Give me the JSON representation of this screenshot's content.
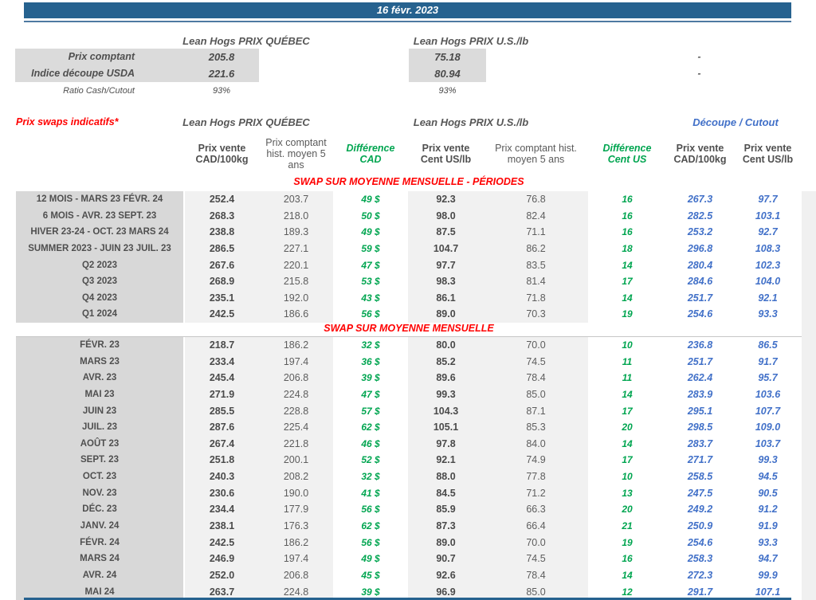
{
  "colors": {
    "header_bar": "#26628F",
    "accent_red": "#FF0000",
    "accent_green": "#00A550",
    "accent_blue": "#4170C8",
    "band_grey": "#DBDBDB",
    "label_col_grey": "#D8D8D8",
    "cell_grey": "#F1F1F1"
  },
  "titlebar": {
    "date": "16 févr. 2023"
  },
  "spot": {
    "quebec_header": "Lean Hogs PRIX QUÉBEC",
    "us_header": "Lean Hogs PRIX U.S./lb",
    "rows": [
      {
        "label": "Prix comptant",
        "qc": "205.8",
        "us": "75.18",
        "cutout": "-"
      },
      {
        "label": "Indice découpe USDA",
        "qc": "221.6",
        "us": "80.94",
        "cutout": "-"
      },
      {
        "label": "Ratio Cash/Cutout",
        "qc": "93%",
        "us": "93%",
        "cutout": ""
      }
    ]
  },
  "swaps": {
    "title": "Prix swaps indicatifs*",
    "quebec_header": "Lean Hogs PRIX QUÉBEC",
    "us_header": "Lean Hogs PRIX U.S./lb",
    "cutout_header": "Découpe / Cutout",
    "columns": [
      {
        "label": "Prix vente CAD/100kg"
      },
      {
        "label": "Prix comptant hist. moyen 5 ans"
      },
      {
        "label": "Différence CAD"
      },
      {
        "label": "Prix vente Cent US/lb"
      },
      {
        "label": "Prix comptant hist. moyen 5 ans"
      },
      {
        "label": "Différence Cent US"
      },
      {
        "label": "Prix vente CAD/100kg"
      },
      {
        "label": "Prix vente Cent US/lb"
      }
    ],
    "periods_title": "SWAP SUR MOYENNE MENSUELLE - PÉRIODES",
    "monthly_title": "SWAP SUR MOYENNE MENSUELLE",
    "periods": [
      {
        "label": "12 MOIS - MARS 23 FÉVR. 24",
        "qc_sell": "252.4",
        "qc_hist": "203.7",
        "diff_cad": "49 $",
        "us_sell": "92.3",
        "us_hist": "76.8",
        "diff_us": "16",
        "cut_cad": "267.3",
        "cut_us": "97.7"
      },
      {
        "label": "6 MOIS - AVR. 23 SEPT. 23",
        "qc_sell": "268.3",
        "qc_hist": "218.0",
        "diff_cad": "50 $",
        "us_sell": "98.0",
        "us_hist": "82.4",
        "diff_us": "16",
        "cut_cad": "282.5",
        "cut_us": "103.1"
      },
      {
        "label": "HIVER 23-24 -  OCT. 23 MARS 24",
        "qc_sell": "238.8",
        "qc_hist": "189.3",
        "diff_cad": "49 $",
        "us_sell": "87.5",
        "us_hist": "71.1",
        "diff_us": "16",
        "cut_cad": "253.2",
        "cut_us": "92.7"
      },
      {
        "label": "SUMMER 2023 - JUIN 23 JUIL. 23",
        "qc_sell": "286.5",
        "qc_hist": "227.1",
        "diff_cad": "59 $",
        "us_sell": "104.7",
        "us_hist": "86.2",
        "diff_us": "18",
        "cut_cad": "296.8",
        "cut_us": "108.3"
      },
      {
        "label": "Q2 2023",
        "qc_sell": "267.6",
        "qc_hist": "220.1",
        "diff_cad": "47 $",
        "us_sell": "97.7",
        "us_hist": "83.5",
        "diff_us": "14",
        "cut_cad": "280.4",
        "cut_us": "102.3"
      },
      {
        "label": "Q3 2023",
        "qc_sell": "268.9",
        "qc_hist": "215.8",
        "diff_cad": "53 $",
        "us_sell": "98.3",
        "us_hist": "81.4",
        "diff_us": "17",
        "cut_cad": "284.6",
        "cut_us": "104.0"
      },
      {
        "label": "Q4 2023",
        "qc_sell": "235.1",
        "qc_hist": "192.0",
        "diff_cad": "43 $",
        "us_sell": "86.1",
        "us_hist": "71.8",
        "diff_us": "14",
        "cut_cad": "251.7",
        "cut_us": "92.1"
      },
      {
        "label": "Q1 2024",
        "qc_sell": "242.5",
        "qc_hist": "186.6",
        "diff_cad": "56 $",
        "us_sell": "89.0",
        "us_hist": "70.3",
        "diff_us": "19",
        "cut_cad": "254.6",
        "cut_us": "93.3"
      }
    ],
    "monthly": [
      {
        "label": "FÉVR. 23",
        "qc_sell": "218.7",
        "qc_hist": "186.2",
        "diff_cad": "32 $",
        "us_sell": "80.0",
        "us_hist": "70.0",
        "diff_us": "10",
        "cut_cad": "236.8",
        "cut_us": "86.5"
      },
      {
        "label": "MARS 23",
        "qc_sell": "233.4",
        "qc_hist": "197.4",
        "diff_cad": "36 $",
        "us_sell": "85.2",
        "us_hist": "74.5",
        "diff_us": "11",
        "cut_cad": "251.7",
        "cut_us": "91.7"
      },
      {
        "label": "AVR. 23",
        "qc_sell": "245.4",
        "qc_hist": "206.8",
        "diff_cad": "39 $",
        "us_sell": "89.6",
        "us_hist": "78.4",
        "diff_us": "11",
        "cut_cad": "262.4",
        "cut_us": "95.7"
      },
      {
        "label": "MAI 23",
        "qc_sell": "271.9",
        "qc_hist": "224.8",
        "diff_cad": "47 $",
        "us_sell": "99.3",
        "us_hist": "85.0",
        "diff_us": "14",
        "cut_cad": "283.9",
        "cut_us": "103.6"
      },
      {
        "label": "JUIN 23",
        "qc_sell": "285.5",
        "qc_hist": "228.8",
        "diff_cad": "57 $",
        "us_sell": "104.3",
        "us_hist": "87.1",
        "diff_us": "17",
        "cut_cad": "295.1",
        "cut_us": "107.7"
      },
      {
        "label": "JUIL. 23",
        "qc_sell": "287.6",
        "qc_hist": "225.4",
        "diff_cad": "62 $",
        "us_sell": "105.1",
        "us_hist": "85.3",
        "diff_us": "20",
        "cut_cad": "298.5",
        "cut_us": "109.0"
      },
      {
        "label": "AOÛT 23",
        "qc_sell": "267.4",
        "qc_hist": "221.8",
        "diff_cad": "46 $",
        "us_sell": "97.8",
        "us_hist": "84.0",
        "diff_us": "14",
        "cut_cad": "283.7",
        "cut_us": "103.7"
      },
      {
        "label": "SEPT. 23",
        "qc_sell": "251.8",
        "qc_hist": "200.1",
        "diff_cad": "52 $",
        "us_sell": "92.1",
        "us_hist": "74.9",
        "diff_us": "17",
        "cut_cad": "271.7",
        "cut_us": "99.3"
      },
      {
        "label": "OCT. 23",
        "qc_sell": "240.3",
        "qc_hist": "208.2",
        "diff_cad": "32 $",
        "us_sell": "88.0",
        "us_hist": "77.8",
        "diff_us": "10",
        "cut_cad": "258.5",
        "cut_us": "94.5"
      },
      {
        "label": "NOV. 23",
        "qc_sell": "230.6",
        "qc_hist": "190.0",
        "diff_cad": "41 $",
        "us_sell": "84.5",
        "us_hist": "71.2",
        "diff_us": "13",
        "cut_cad": "247.5",
        "cut_us": "90.5"
      },
      {
        "label": "DÉC. 23",
        "qc_sell": "234.4",
        "qc_hist": "177.9",
        "diff_cad": "56 $",
        "us_sell": "85.9",
        "us_hist": "66.3",
        "diff_us": "20",
        "cut_cad": "249.2",
        "cut_us": "91.2"
      },
      {
        "label": "JANV. 24",
        "qc_sell": "238.1",
        "qc_hist": "176.3",
        "diff_cad": "62 $",
        "us_sell": "87.3",
        "us_hist": "66.4",
        "diff_us": "21",
        "cut_cad": "250.9",
        "cut_us": "91.9"
      },
      {
        "label": "FÉVR. 24",
        "qc_sell": "242.5",
        "qc_hist": "186.2",
        "diff_cad": "56 $",
        "us_sell": "89.0",
        "us_hist": "70.0",
        "diff_us": "19",
        "cut_cad": "254.6",
        "cut_us": "93.3"
      },
      {
        "label": "MARS 24",
        "qc_sell": "246.9",
        "qc_hist": "197.4",
        "diff_cad": "49 $",
        "us_sell": "90.7",
        "us_hist": "74.5",
        "diff_us": "16",
        "cut_cad": "258.3",
        "cut_us": "94.7"
      },
      {
        "label": "AVR. 24",
        "qc_sell": "252.0",
        "qc_hist": "206.8",
        "diff_cad": "45 $",
        "us_sell": "92.6",
        "us_hist": "78.4",
        "diff_us": "14",
        "cut_cad": "272.3",
        "cut_us": "99.9"
      },
      {
        "label": "MAI 24",
        "qc_sell": "263.7",
        "qc_hist": "224.8",
        "diff_cad": "39 $",
        "us_sell": "96.9",
        "us_hist": "85.0",
        "diff_us": "12",
        "cut_cad": "291.7",
        "cut_us": "107.1"
      }
    ]
  }
}
